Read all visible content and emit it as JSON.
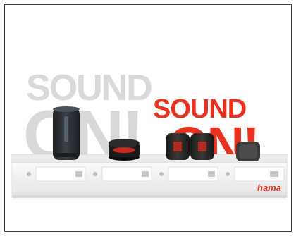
{
  "display": {
    "headline_left": [
      "SOUND",
      "ON!"
    ],
    "headline_right": [
      "SOUND",
      "ON!"
    ],
    "brand": "hama"
  },
  "colors": {
    "accent_red": "#e8321f",
    "ghost_grey": "#d6d6d6",
    "base_white": "#f2f2f2"
  }
}
